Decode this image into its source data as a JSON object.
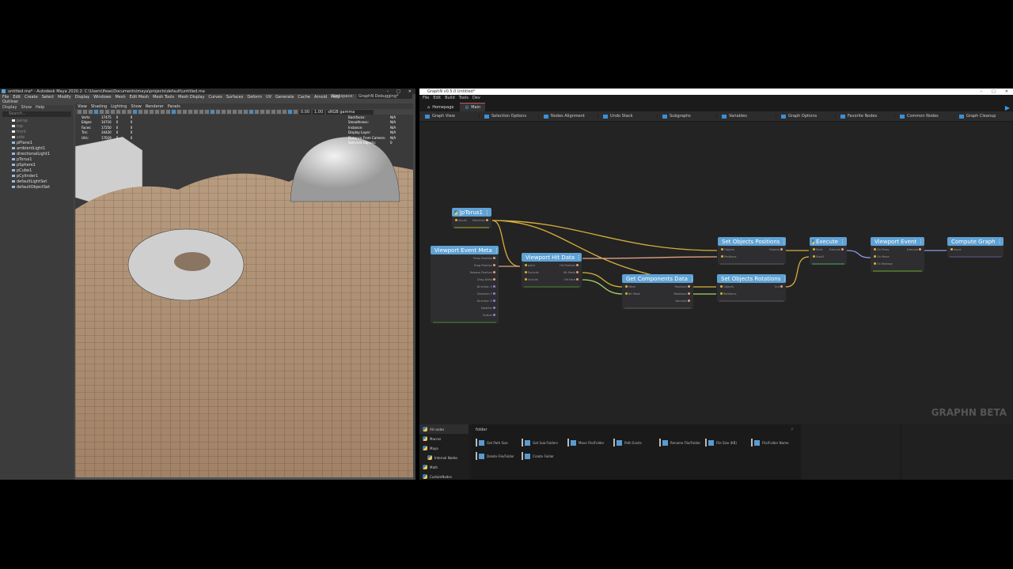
{
  "maya": {
    "title": "untitled.ma* - Autodesk Maya 2020.2: C:\\Users\\Ifeas\\Documents\\maya\\projects\\default\\untitled.ma",
    "menu": [
      "File",
      "Edit",
      "Create",
      "Select",
      "Modify",
      "Display",
      "Windows",
      "Mesh",
      "Edit Mesh",
      "Mesh Tools",
      "Mesh Display",
      "Curves",
      "Surfaces",
      "Deform",
      "UV",
      "Generate",
      "Cache",
      "Arnold",
      "Help"
    ],
    "workspace_label": "Workspace:",
    "workspace": "GraphN Debugging*",
    "outliner": {
      "title": "Outliner",
      "menu": [
        "Display",
        "Show",
        "Help"
      ],
      "search_placeholder": "Search...",
      "items": [
        "persp",
        "top",
        "front",
        "side",
        "pPlane1",
        "ambientLight1",
        "directionalLight1",
        "pTorus1",
        "pSphere1",
        "pCube1",
        "pCylinder1",
        "defaultLightSet",
        "defaultObjectSet"
      ]
    },
    "viewport": {
      "menu": [
        "View",
        "Shading",
        "Lighting",
        "Show",
        "Renderer",
        "Panels"
      ],
      "exposure": "0.00",
      "gamma": "1.00",
      "colorspace": "sRGB gamma",
      "hud_left": [
        [
          "Verts:",
          "17475",
          "0",
          "0"
        ],
        [
          "Edges:",
          "34716",
          "0",
          "0"
        ],
        [
          "Faces:",
          "17250",
          "0",
          "0"
        ],
        [
          "Tris:",
          "34420",
          "0",
          "0"
        ],
        [
          "UVs:",
          "17619",
          "0",
          "0"
        ]
      ],
      "hud_right": [
        [
          "Backfaces:",
          "N/A"
        ],
        [
          "Smoothness:",
          "N/A"
        ],
        [
          "Instance:",
          "N/A"
        ],
        [
          "Display Layer:",
          "N/A"
        ],
        [
          "Distance From Camera:",
          "N/A"
        ],
        [
          "Selected Objects:",
          "0"
        ]
      ]
    }
  },
  "graphn": {
    "title": "GraphN v0.5.0 Untitled*",
    "menu": [
      "File",
      "Edit",
      "Build",
      "Tools",
      "Dev"
    ],
    "tabs": [
      "Homepage",
      "Main"
    ],
    "toolbar": [
      "Graph View",
      "Selection Options",
      "Nodes Alignment",
      "Undo Stack",
      "Subgraphs",
      "Variables",
      "Graph Options",
      "Favorite Nodes",
      "Common Nodes",
      "Graph Cleanup"
    ],
    "watermark": "GRAPHN BETA",
    "nodes": [
      {
        "title": "|pTorus1",
        "in": [
          "Inputs"
        ],
        "out": [
          "Selection"
        ]
      },
      {
        "title": "Viewport Event Meta",
        "in": [],
        "out": [
          "Press Position",
          "Drag Position",
          "Release Position",
          "Drag Delta",
          "Direction X",
          "Direction Y",
          "Direction Z",
          "Modifier",
          "Button"
        ]
      },
      {
        "title": "Viewport Hit Data",
        "in": [
          "point",
          "Exclude",
          "Include"
        ],
        "out": [
          "Hit Position",
          "Hit Mesh",
          "Hit Face"
        ]
      },
      {
        "title": "Get Components Data",
        "in": [
          "Mesh",
          "Bit Mask"
        ],
        "out": [
          "Positions",
          "Rotations",
          "Normals"
        ]
      },
      {
        "title": "Set Objects Positions",
        "in": [
          "Objects",
          "Positions"
        ],
        "out": [
          "Objects"
        ]
      },
      {
        "title": "Set Objects Rotations",
        "in": [
          "Objects",
          "Rotations"
        ],
        "out": [
          "Out"
        ]
      },
      {
        "title": "Execute",
        "in": [
          "Start",
          "Start1"
        ],
        "out": [
          "Execute"
        ]
      },
      {
        "title": "Viewport Event",
        "in": [
          "On Press",
          "On Move",
          "On Release"
        ],
        "out": [
          "Execute"
        ]
      },
      {
        "title": "Compute Graph",
        "in": [
          "Input"
        ],
        "out": []
      }
    ],
    "library": {
      "categories": [
        "All nodes",
        "Macros",
        "Maya",
        "Internal Nodes",
        "Math",
        "CustomNodes"
      ],
      "search": "folder",
      "tiles": [
        "Get Path Size",
        "Get Sub-Folders",
        "Move File/Folder",
        "Path Exists",
        "Rename File/Folder",
        "File Size (KB)",
        "File/Folder Name",
        "Delete File/Folder",
        "Create Folder"
      ]
    }
  }
}
